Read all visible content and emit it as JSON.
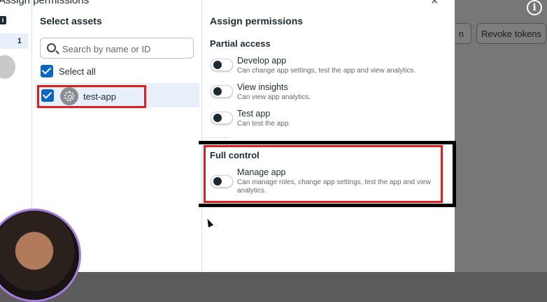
{
  "modal": {
    "title": "Assign permissions",
    "close_glyph": "×"
  },
  "left_rail": {
    "info_glyph": "i",
    "selected_count": "1"
  },
  "assets": {
    "header": "Select assets",
    "search_placeholder": "Search by name or ID",
    "select_all_label": "Select all",
    "items": [
      {
        "name": "test-app",
        "checked": true,
        "icon": "app-gear-icon"
      }
    ]
  },
  "permissions": {
    "header": "Assign permissions",
    "partial": {
      "title": "Partial access",
      "items": [
        {
          "name": "Develop app",
          "desc": "Can change app settings, test the app and view analytics.",
          "enabled": false
        },
        {
          "name": "View insights",
          "desc": "Can view app analytics.",
          "enabled": false
        },
        {
          "name": "Test app",
          "desc": "Can test the app.",
          "enabled": false
        }
      ]
    },
    "full": {
      "title": "Full control",
      "items": [
        {
          "name": "Manage app",
          "desc_line1": "Can manage roles, change app settings, test the app and view",
          "desc_line2": "analytics.",
          "enabled": false
        }
      ]
    }
  },
  "background": {
    "button_partial_label": "n",
    "revoke_tokens_label": "Revoke tokens",
    "info_glyph": "i"
  },
  "colors": {
    "accent": "#0a66c2",
    "highlight": "#e01e1e",
    "selected_row": "#e7f0fa"
  }
}
